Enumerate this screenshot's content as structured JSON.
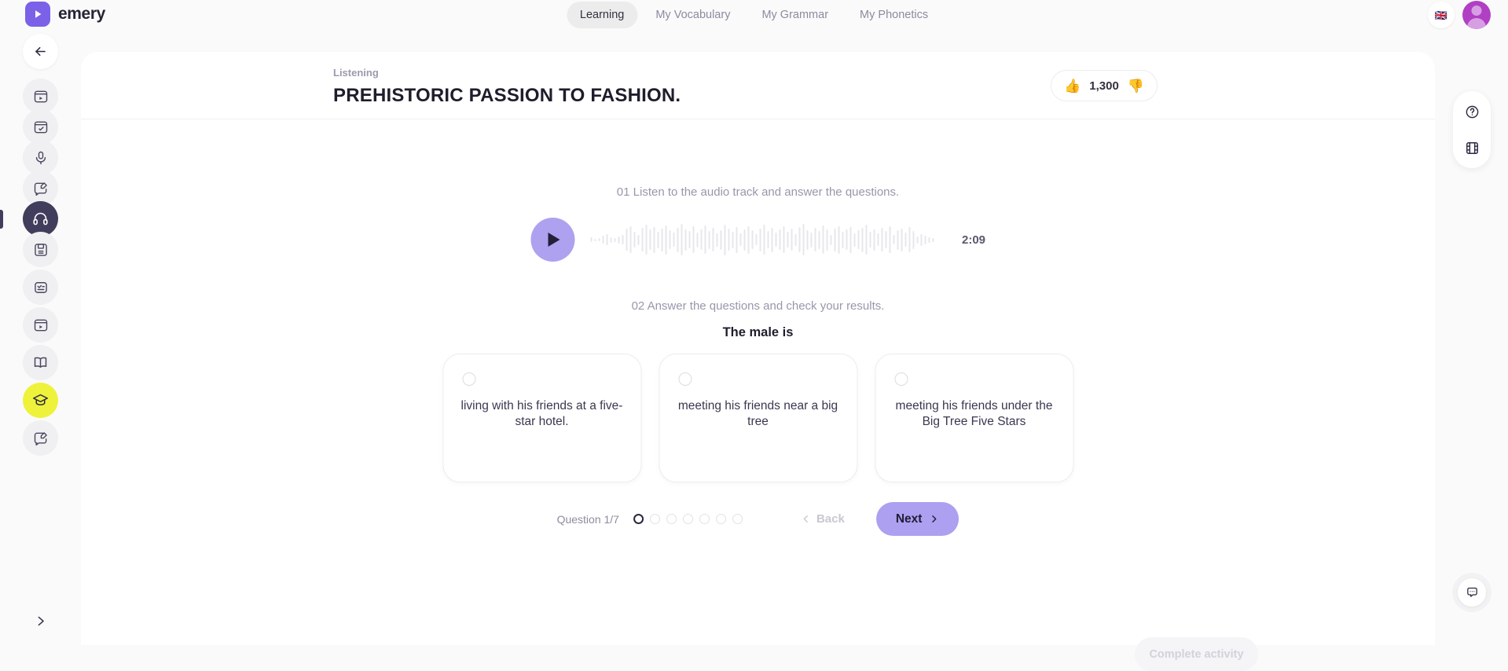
{
  "brand": {
    "name": "emery",
    "logo_icon": "play-logo-icon",
    "accent": "#7b61e8"
  },
  "nav": {
    "tabs": [
      {
        "label": "Learning",
        "active": true
      },
      {
        "label": "My Vocabulary",
        "active": false
      },
      {
        "label": "My Grammar",
        "active": false
      },
      {
        "label": "My Phonetics",
        "active": false
      }
    ]
  },
  "top_right": {
    "language_flag": "🇬🇧",
    "language_icon": "uk-flag-icon",
    "avatar_icon": "user-avatar-icon"
  },
  "sidebar": {
    "back_icon": "back-arrow-icon",
    "expand_icon": "chevron-right-icon",
    "items": [
      {
        "icon": "video-lesson-icon",
        "active": false
      },
      {
        "icon": "calendar-check-icon",
        "active": false
      },
      {
        "icon": "microphone-icon",
        "active": false
      },
      {
        "icon": "message-edit-icon",
        "active": false
      },
      {
        "icon": "headphones-icon",
        "active": true,
        "style": "dark"
      },
      {
        "icon": "save-disk-icon",
        "active": false
      },
      {
        "icon": "quiz-card-icon",
        "active": false
      },
      {
        "icon": "video-lesson-icon",
        "active": false
      },
      {
        "icon": "open-book-icon",
        "active": false
      },
      {
        "icon": "graduation-cap-icon",
        "active": true,
        "style": "yellow"
      },
      {
        "icon": "message-edit-icon",
        "active": false
      }
    ]
  },
  "header": {
    "kicker": "Listening",
    "title": "PREHISTORIC PASSION TO FASHION.",
    "rating": {
      "thumbs_up_icon": "👍",
      "count": "1,300",
      "thumbs_down_icon": "👎"
    }
  },
  "activity": {
    "step1_label": "01 Listen to the audio track and answer the questions.",
    "step2_label": "02 Answer the questions and check your results.",
    "player": {
      "play_icon": "play-icon",
      "duration": "2:09"
    },
    "question_text": "The male is",
    "options": [
      {
        "text": "living with his friends at a five-star hotel.",
        "selected": false
      },
      {
        "text": "meeting his friends near a big tree",
        "selected": false
      },
      {
        "text": "meeting his friends under the Big Tree Five Stars",
        "selected": false
      }
    ],
    "pager": {
      "label": "Question 1/7",
      "total_dots": 7,
      "active_index": 0,
      "back_label": "Back",
      "back_icon": "chevron-left-icon",
      "next_label": "Next",
      "next_icon": "chevron-right-icon"
    },
    "complete_label": "Complete activity"
  },
  "right_rail": {
    "help_icon": "question-circle-icon",
    "layout_icon": "film-grid-icon",
    "chat_icon": "chat-bubble-icon"
  }
}
